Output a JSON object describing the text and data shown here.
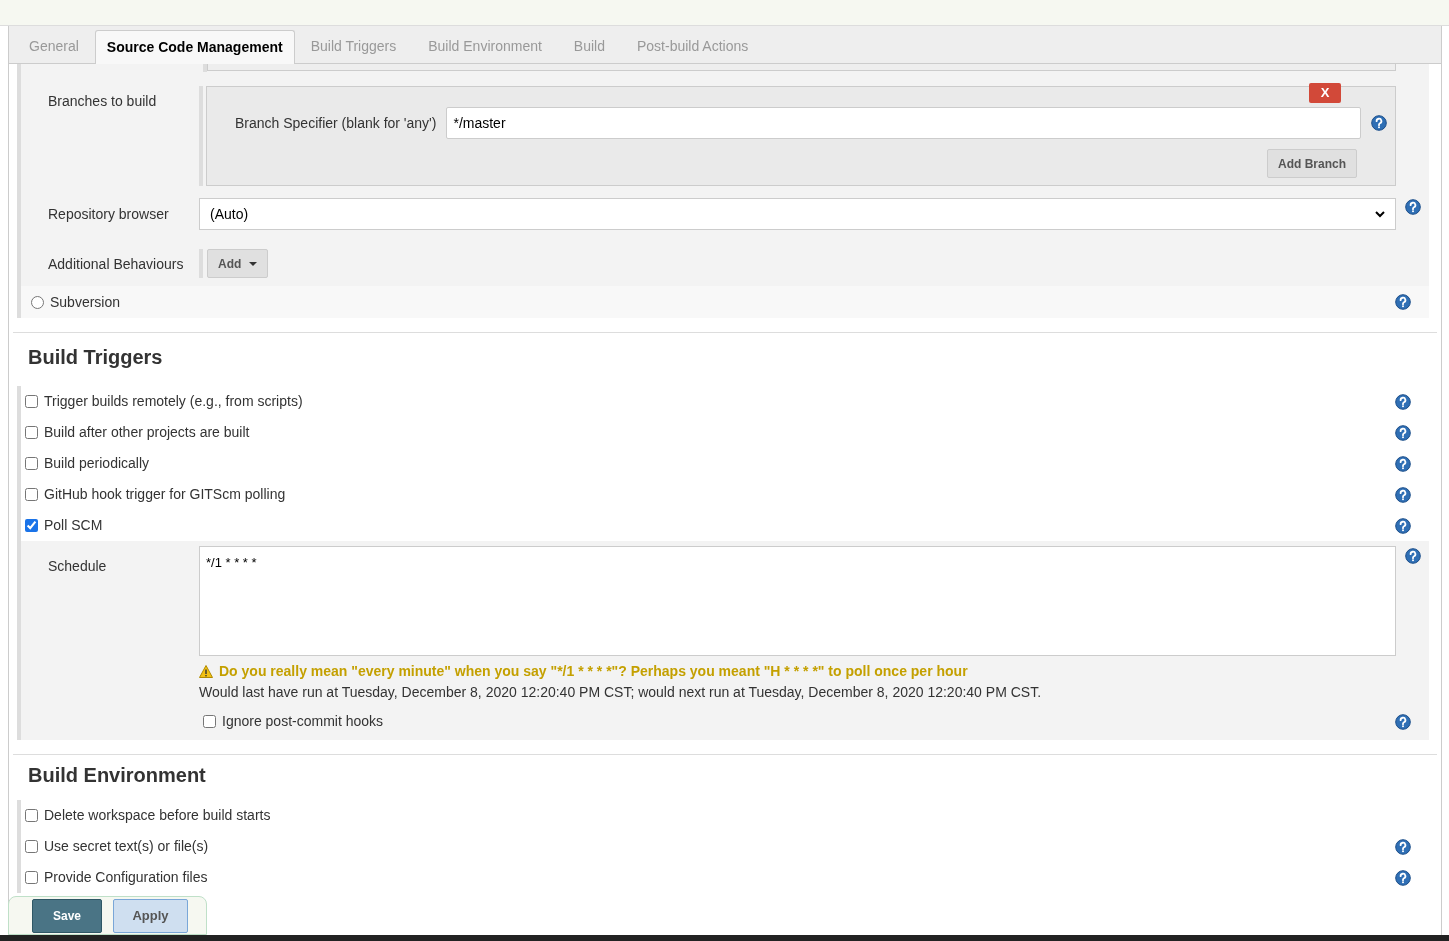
{
  "tabs": [
    {
      "label": "General",
      "selected": false
    },
    {
      "label": "Source Code Management",
      "selected": true
    },
    {
      "label": "Build Triggers",
      "selected": false
    },
    {
      "label": "Build Environment",
      "selected": false
    },
    {
      "label": "Build",
      "selected": false
    },
    {
      "label": "Post-build Actions",
      "selected": false
    }
  ],
  "scm": {
    "branches_label": "Branches to build",
    "branch_specifier_label": "Branch Specifier (blank for 'any')",
    "branch_value": "*/master",
    "delete_button": "X",
    "add_branch_button": "Add Branch",
    "repo_browser_label": "Repository browser",
    "repo_browser_value": "(Auto)",
    "additional_behaviours_label": "Additional Behaviours",
    "add_button": "Add",
    "subversion": {
      "label": "Subversion",
      "selected": false
    }
  },
  "build_triggers": {
    "title": "Build Triggers",
    "options": [
      {
        "label": "Trigger builds remotely (e.g., from scripts)",
        "checked": false
      },
      {
        "label": "Build after other projects are built",
        "checked": false
      },
      {
        "label": "Build periodically",
        "checked": false
      },
      {
        "label": "GitHub hook trigger for GITScm polling",
        "checked": false
      },
      {
        "label": "Poll SCM",
        "checked": true
      }
    ],
    "schedule": {
      "label": "Schedule",
      "value": "*/1 * * * *",
      "warning": "Do you really mean \"every minute\" when you say \"*/1 * * * *\"? Perhaps you meant \"H * * * *\" to poll once per hour",
      "info": "Would last have run at Tuesday, December 8, 2020 12:20:40 PM CST; would next run at Tuesday, December 8, 2020 12:20:40 PM CST.",
      "ignore_hooks": {
        "label": "Ignore post-commit hooks",
        "checked": false
      }
    }
  },
  "build_environment": {
    "title": "Build Environment",
    "options": [
      {
        "label": "Delete workspace before build starts",
        "checked": false
      },
      {
        "label": "Use secret text(s) or file(s)",
        "checked": false
      },
      {
        "label": "Provide Configuration files",
        "checked": false
      }
    ]
  },
  "buttons": [
    {
      "label": "Save",
      "kind": "primary"
    },
    {
      "label": "Apply",
      "kind": "secondary"
    }
  ]
}
